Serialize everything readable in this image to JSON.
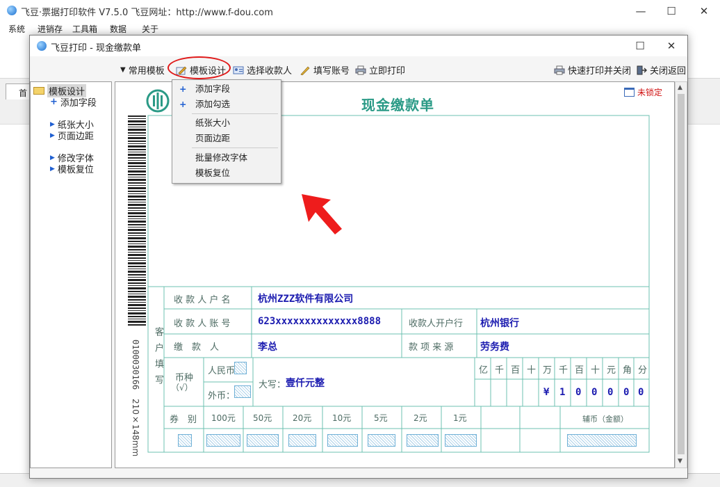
{
  "outer": {
    "title": "飞豆·票据打印软件 V7.5.0   飞豆网址：http://www.f-dou.com",
    "menu": [
      "系统",
      "进销存",
      "工具箱",
      "数据",
      "关于"
    ],
    "first_tab": "首"
  },
  "dialog": {
    "title": "飞豆打印 - 现金缴款单",
    "toolbar": {
      "common_templates": "常用模板",
      "template_design": "模板设计",
      "select_payee": "选择收款人",
      "fill_account": "填写账号",
      "print_now": "立即打印",
      "quick_print_close": "快速打印并关闭",
      "close_return": "关闭返回"
    },
    "tree": {
      "root": "模板设计",
      "items": [
        "添加字段",
        "纸张大小",
        "页面边距",
        "修改字体",
        "模板复位"
      ]
    },
    "lock_status": "未锁定"
  },
  "context_menu": {
    "items": [
      "添加字段",
      "添加勾选",
      "纸张大小",
      "页面边距",
      "批量修改字体",
      "模板复位"
    ]
  },
  "form": {
    "title": "现金缴款单",
    "side_code": "0100030166",
    "paper_size": "210×148mm",
    "customer_label": "客户填写",
    "payee_name_label": "收 款 人 户 名",
    "payee_name": "杭州ZZZ软件有限公司",
    "payee_account_label": "收 款 人 账 号",
    "payee_account": "623xxxxxxxxxxxxxx8888",
    "bank_label": "收款人开户行",
    "bank": "杭州银行",
    "payer_label": "缴　款　人",
    "payer": "李总",
    "source_label": "款 项 来 源",
    "source": "劳务费",
    "currency_label": "币种",
    "currency_check": "（√）",
    "rmb_label": "人民币",
    "foreign_label": "外币：",
    "amount_words_label": "大写：",
    "amount_words": "壹仟元整",
    "digit_headers": [
      "亿",
      "千",
      "百",
      "十",
      "万",
      "千",
      "百",
      "十",
      "元",
      "角",
      "分"
    ],
    "digits": [
      "",
      "",
      "",
      "",
      "¥",
      "1",
      "0",
      "0",
      "0",
      "0",
      "0"
    ],
    "coupon_label": "券　别",
    "denominations": [
      "100元",
      "50元",
      "20元",
      "10元",
      "5元",
      "2元",
      "1元"
    ],
    "auxiliary_label": "辅币（金额）"
  }
}
